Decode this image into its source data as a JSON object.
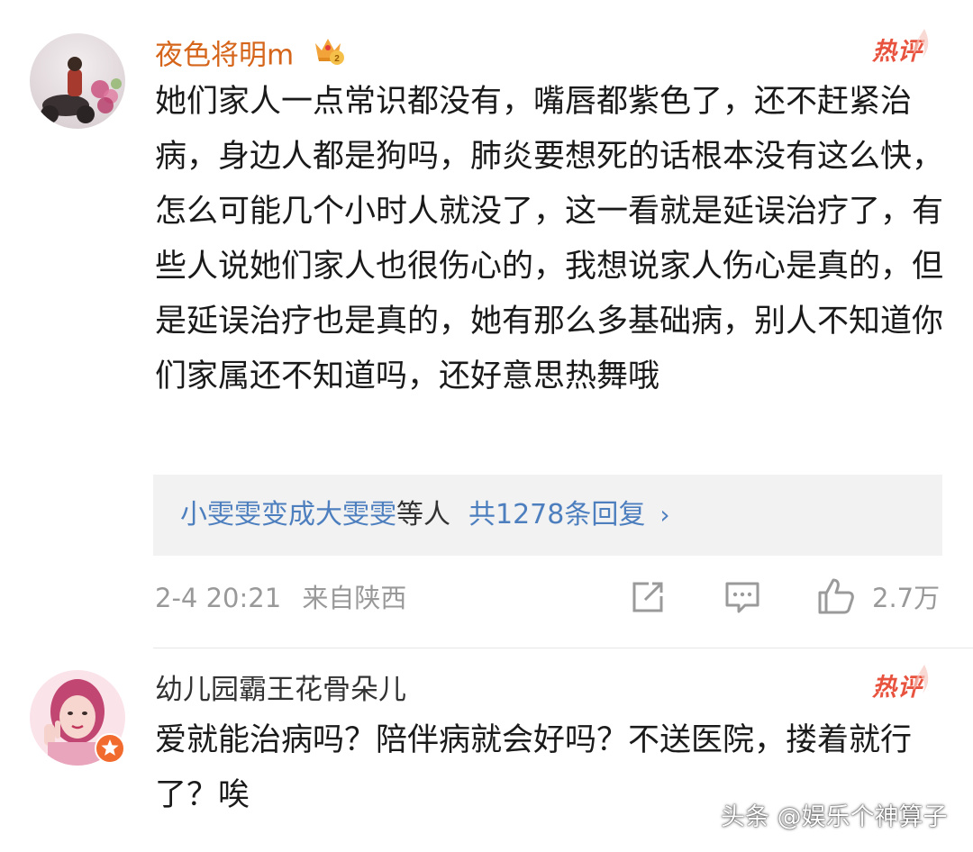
{
  "colors": {
    "username_vip": "#d5651a",
    "username_normal": "#333333",
    "hot_badge": "#e8533f",
    "link_blue": "#4d7fbf",
    "meta_gray": "#999999",
    "body_text": "#1a1a1a",
    "reply_bg": "#f2f2f2"
  },
  "comments": [
    {
      "username": "夜色将明m",
      "vip_badge_icon": "crown-vip-icon",
      "vip_level": "2",
      "hot_label": "热评",
      "text": "她们家人一点常识都没有，嘴唇都紫色了，还不赶紧治病，身边人都是狗吗，肺炎要想死的话根本没有这么快，怎么可能几个小时人就没了，这一看就是延误治疗了，有些人说她们家人也很伤心的，我想说家人伤心是真的，但是延误治疗也是真的，她有那么多基础病，别人不知道你们家属还不知道吗，还好意思热舞哦",
      "replies": {
        "names": "小雯雯变成大雯雯",
        "etc": "等人",
        "count": "共1278条回复",
        "chevron_icon": "chevron-right-icon"
      },
      "timestamp": "2-4 20:21",
      "location": "来自陕西",
      "actions": {
        "share_icon": "share-icon",
        "comment_icon": "comment-icon",
        "like_icon": "thumbs-up-icon",
        "like_count": "2.7万"
      }
    },
    {
      "username": "幼儿园霸王花骨朵儿",
      "verified_icon": "star-badge-icon",
      "hot_label": "热评",
      "text": "爱就能治病吗？陪伴病就会好吗？不送医院，搂着就行了？唉"
    }
  ],
  "watermark": "头条 @娱乐个神算子"
}
